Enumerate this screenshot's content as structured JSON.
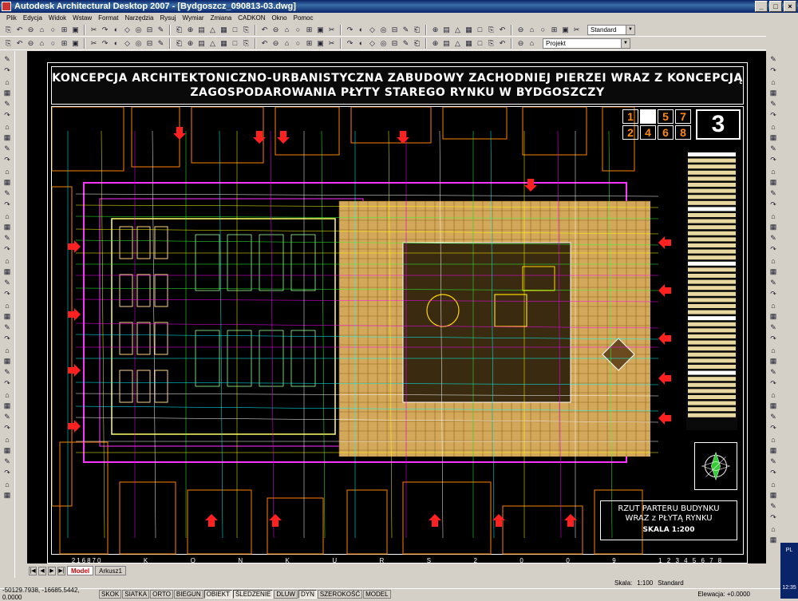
{
  "window": {
    "title": "Autodesk Architectural Desktop 2007 - [Bydgoszcz_090813-03.dwg]",
    "buttons": [
      "_",
      "□",
      "×"
    ]
  },
  "menu": [
    "Plik",
    "Edycja",
    "Widok",
    "Wstaw",
    "Format",
    "Narzędzia",
    "Rysuj",
    "Wymiar",
    "Zmiana",
    "CADKON",
    "Okno",
    "Pomoc"
  ],
  "toolbar": {
    "style_combo": "Standard",
    "layer_combo": "Projekt"
  },
  "drawing": {
    "title_line1": "KONCEPCJA ARCHITEKTONICZNO-URBANISTYCZNA ZABUDOWY ZACHODNIEJ PIERZEI WRAZ Z KONCEPCJĄ",
    "title_line2": "ZAGOSPODAROWANIA PŁYTY STAREGO RYNKU W BYDGOSZCZY",
    "sheet_numbers": [
      "1",
      "",
      "5",
      "7",
      "2",
      "4",
      "6",
      "8"
    ],
    "sheet_number": "3",
    "caption_line1": "RZUT PARTERU BUDYNKU",
    "caption_line2": "WRAZ z PŁYTĄ RYNKU",
    "scale": "SKALA 1:200",
    "bottom_code": "216870",
    "bottom_letters": [
      "K",
      "O",
      "N",
      "K",
      "U",
      "R",
      "S",
      "2",
      "0",
      "0",
      "9"
    ],
    "sheet_index": "1 2 3 4 5 6 7 8"
  },
  "tabs": {
    "model": "Model",
    "layout": "Arkusz1"
  },
  "status": {
    "scale_label": "Skala:",
    "scale_value": "1:100",
    "style_value": "Standard",
    "coords": "-50129.7938, -16685.5442, 0.0000",
    "buttons": [
      "SKOK",
      "SIATKA",
      "ORTO",
      "BIEGUN",
      "OBIEKT",
      "ŚLEDZENIE",
      "DLUW",
      "DYN",
      "SZEROKOŚĆ",
      "MODEL"
    ],
    "elevation_label": "Elewacja:",
    "elevation_value": "+0.0000",
    "lang": "PL",
    "time": "12:35"
  }
}
